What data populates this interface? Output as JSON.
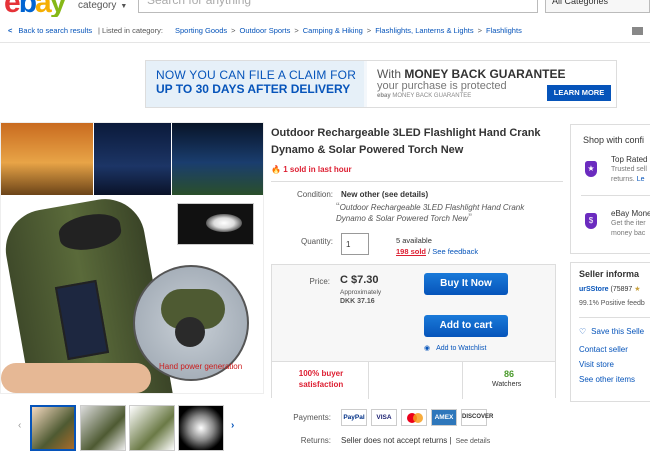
{
  "header": {
    "logo": {
      "e": "e",
      "b": "b",
      "a": "a",
      "y": "y"
    },
    "category_label": "category",
    "search_placeholder": "Search for anything",
    "all_categories": "All Categories"
  },
  "breadcrumb": {
    "back": "Back to search results",
    "listed_in": "Listed in category:",
    "path": [
      "Sporting Goods",
      "Outdoor Sports",
      "Camping & Hiking",
      "Flashlights, Lanterns & Lights",
      "Flashlights"
    ]
  },
  "banner": {
    "left_line1": "NOW YOU CAN FILE A CLAIM FOR",
    "left_line2": "UP TO 30 DAYS AFTER DELIVERY",
    "right_line1_a": "With ",
    "right_line1_b": "MONEY BACK GUARANTEE",
    "right_line2": "your purchase is protected",
    "right_line3": "ebay",
    "right_line3b": "MONEY BACK GUARANTEE",
    "learn_more": "LEARN MORE"
  },
  "gallery": {
    "caption": "Hand power generation"
  },
  "item": {
    "title": "Outdoor Rechargeable 3LED Flashlight Hand Crank Dynamo & Solar Powered Torch New",
    "sold_last_hour": "1 sold in last hour",
    "condition_label": "Condition:",
    "condition_value": "New other (see details)",
    "condition_quote": "Outdoor Rechargeable 3LED Flashlight Hand Crank Dynamo & Solar Powered Torch New",
    "quantity_label": "Quantity:",
    "quantity_value": "1",
    "available": "5 available",
    "sold_count": "198 sold",
    "feedback_sep": " / ",
    "see_feedback": "See feedback"
  },
  "buybox": {
    "price_label": "Price:",
    "price": "C $7.30",
    "approx": "Approximately",
    "dkk": "DKK 37.16",
    "buy_now": "Buy It Now",
    "add_cart": "Add to cart",
    "add_watchlist": "Add to Watchlist",
    "satisfaction": "100% buyer satisfaction",
    "watchers_count": "86",
    "watchers_label": "Watchers"
  },
  "payments": {
    "label": "Payments:",
    "icons": [
      "PayPal",
      "VISA",
      "MasterCard",
      "AMEX",
      "DISCOVER"
    ],
    "returns_label": "Returns:",
    "returns_value": "Seller does not accept returns |",
    "see_details": "See details"
  },
  "shop_box": {
    "heading": "Shop with confi",
    "trust1": "Top Rated",
    "trust2": "Trusted sell",
    "trust3a": "returns. ",
    "trust3b": "Le",
    "mb1": "eBay Mone",
    "mb2": "Get the iter",
    "mb3": "money bac"
  },
  "seller_box": {
    "heading": "Seller informa",
    "store": "urSStore",
    "score": " (75897 ",
    "positive": "99.1% Positive feedb",
    "save": "Save this Selle",
    "contact": "Contact seller",
    "visit": "Visit store",
    "other": "See other items"
  },
  "colors": {
    "accent": "#0654ba",
    "alert": "#dd1e31",
    "watchers": "#4a9a2b",
    "badge": "#6b2bbf"
  }
}
